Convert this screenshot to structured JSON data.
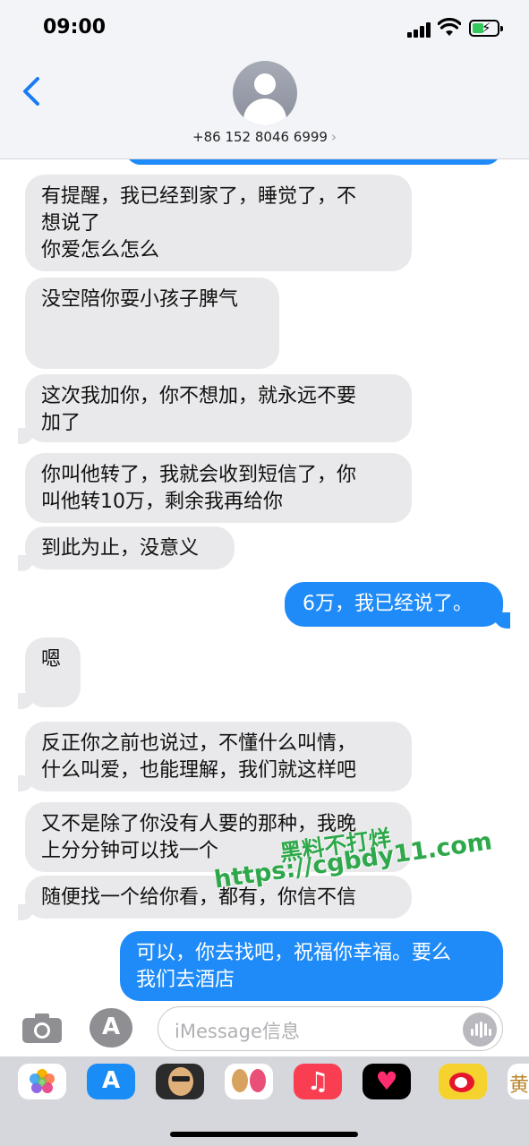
{
  "status_bar": {
    "time": "09:00"
  },
  "header": {
    "contact": "+86 152 8046 6999",
    "chevron": "›"
  },
  "messages": {
    "m1": {
      "line1": "有提醒，我已经到家了，睡觉了，不",
      "line2": "想说了",
      "line3": "你爱怎么怎么"
    },
    "m2": {
      "line1": "没空陪你耍小孩子脾气"
    },
    "m3": {
      "line1": "这次我加你，你不想加，就永远不要",
      "line2": "加了"
    },
    "m4": {
      "line1": "你叫他转了，我就会收到短信了，你",
      "line2": "叫他转10万，剩余我再给你"
    },
    "m5": {
      "line1": "到此为止，没意义"
    },
    "m6": {
      "line1": "6万，我已经说了。"
    },
    "m7": {
      "line1": "嗯"
    },
    "m8": {
      "line1": "反正你之前也说过，不懂什么叫情，",
      "line2": "什么叫爱，也能理解，我们就这样吧"
    },
    "m9": {
      "line1": "又不是除了你没有人要的那种，我晚",
      "line2": "上分分钟可以找一个"
    },
    "m10": {
      "line1": "随便找一个给你看，都有，你信不信"
    },
    "m11": {
      "line1": "可以，你去找吧，祝福你幸福。要么",
      "line2": "我们去酒店"
    }
  },
  "watermark": {
    "line1": "黑料不打烊",
    "line2": "https://cgbdy11.com"
  },
  "composer": {
    "placeholder": "iMessage信息"
  },
  "drawer": {
    "last_app_char": "黄"
  },
  "colors": {
    "outgoing": "#1f8bf8",
    "incoming": "#e9e9eb",
    "link_blue": "#1a7cf5",
    "header_bg": "#f3f4f8"
  },
  "icons": [
    "back-chevron-icon",
    "avatar-icon",
    "camera-icon",
    "app-store-icon",
    "voice-memo-icon",
    "photos-app-icon",
    "app-store-app-icon",
    "memoji-icon",
    "animoji-icon",
    "music-app-icon",
    "digital-touch-icon",
    "weibo-icon"
  ]
}
